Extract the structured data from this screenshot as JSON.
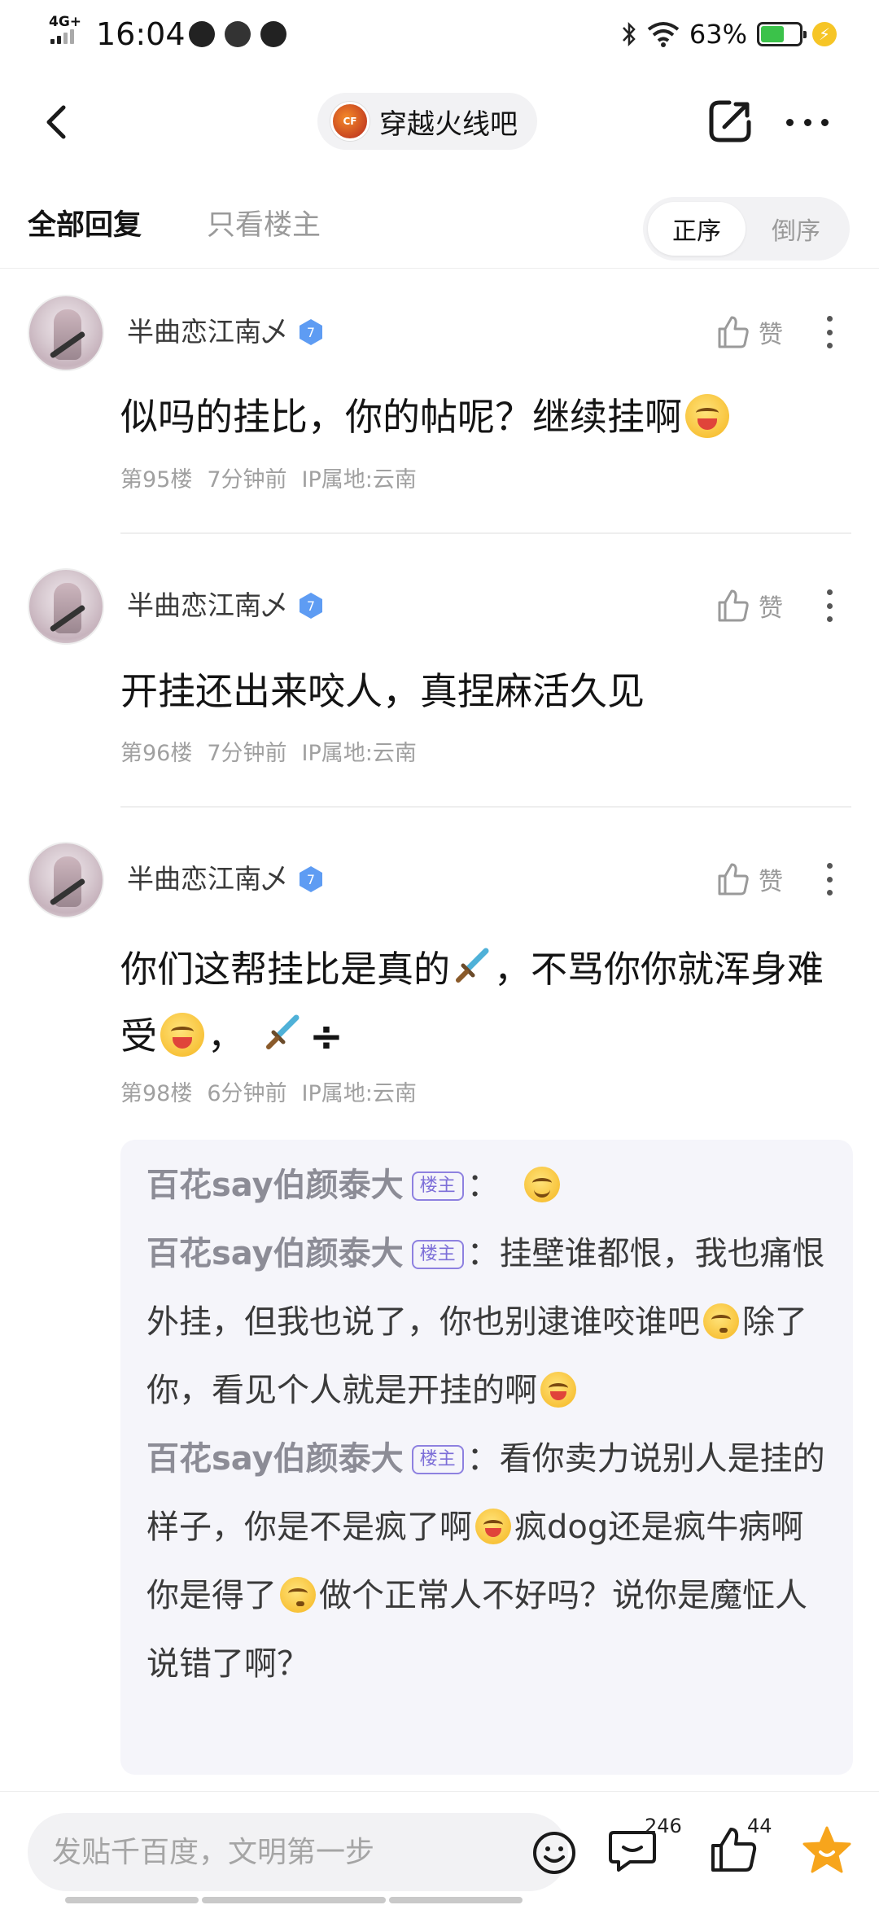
{
  "status_bar": {
    "network": "4G+",
    "time": "16:04",
    "battery_percent": "63%",
    "battery_level": 0.63,
    "battery_color": "#3bc24a"
  },
  "nav": {
    "forum_name": "穿越火线吧",
    "back_icon": "chevron-left-icon",
    "share_icon": "share-icon",
    "more_icon": "more-horizontal-icon"
  },
  "tabs": {
    "all_replies": "全部回复",
    "host_only": "只看楼主",
    "order_asc": "正序",
    "order_desc": "倒序"
  },
  "posts": [
    {
      "author": "半曲恋江南乄",
      "level": "7",
      "like_label": "赞",
      "content": "似吗的挂比，你的帖呢？继续挂啊",
      "floor": "第95楼",
      "time": "7分钟前",
      "ip": "IP属地:云南"
    },
    {
      "author": "半曲恋江南乄",
      "level": "7",
      "like_label": "赞",
      "content": "开挂还出来咬人，真捏麻活久见",
      "floor": "第96楼",
      "time": "7分钟前",
      "ip": "IP属地:云南"
    },
    {
      "author": "半曲恋江南乄",
      "level": "7",
      "like_label": "赞",
      "content_a": "你们这帮挂比是真的",
      "content_b": "，不骂你你就浑身难受",
      "content_c": "，",
      "content_d": "÷",
      "floor": "第98楼",
      "time": "6分钟前",
      "ip": "IP属地:云南"
    }
  ],
  "sub_replies": [
    {
      "author": "百花say伯颜泰大",
      "badge": "楼主",
      "sep": "：",
      "text_a": "",
      "text_b": ""
    },
    {
      "author": "百花say伯颜泰大",
      "badge": "楼主",
      "sep": "：",
      "text_a": "挂壁谁都恨，我也痛恨外挂，但我也说了，你也别逮谁咬谁吧",
      "text_b": "除了你，看见个人就是开挂的啊"
    },
    {
      "author": "百花say伯颜泰大",
      "badge": "楼主",
      "sep": "：",
      "text_a": "看你卖力说别人是挂的样子，你是不是疯了啊",
      "text_b": "疯dog还是疯牛病啊你是得了",
      "text_c": "做个正常人不好吗？说你是魔怔人说错了啊？"
    }
  ],
  "bottom_bar": {
    "input_placeholder": "发贴千百度，文明第一步",
    "comment_count": "246",
    "like_count": "44",
    "accent_color": "#f7a51c"
  }
}
